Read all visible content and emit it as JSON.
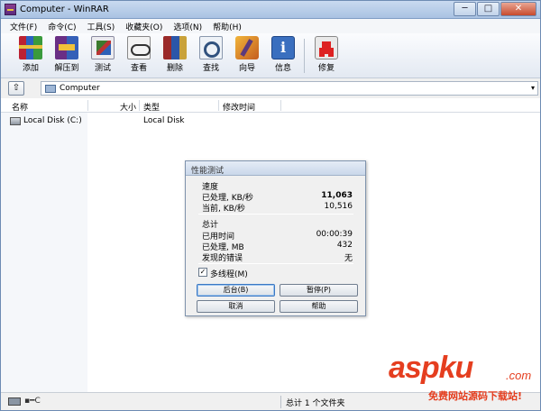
{
  "window": {
    "title": "Computer - WinRAR",
    "minimize": "─",
    "maximize": "□",
    "close": "✕"
  },
  "menu": [
    "文件(F)",
    "命令(C)",
    "工具(S)",
    "收藏夹(O)",
    "选项(N)",
    "帮助(H)"
  ],
  "toolbar": {
    "items": [
      {
        "label": "添加",
        "icon": "add-icon"
      },
      {
        "label": "解压到",
        "icon": "extract-icon"
      },
      {
        "label": "测试",
        "icon": "test-icon"
      },
      {
        "label": "查看",
        "icon": "view-icon"
      },
      {
        "label": "删除",
        "icon": "delete-icon"
      },
      {
        "label": "查找",
        "icon": "find-icon"
      },
      {
        "label": "向导",
        "icon": "wizard-icon"
      },
      {
        "label": "信息",
        "icon": "info-icon"
      },
      {
        "label": "修复",
        "icon": "repair-icon"
      }
    ]
  },
  "address": {
    "up": "⇧",
    "path": "Computer",
    "dropdown": "▾"
  },
  "list": {
    "columns": [
      "名称",
      "大小",
      "类型",
      "修改时间"
    ],
    "rows": [
      {
        "name": "Local Disk (C:)",
        "size": "",
        "type": "Local Disk",
        "modified": ""
      }
    ]
  },
  "dialog": {
    "title": "性能测试",
    "speed_group": "速度",
    "processed_speed_label": "已处理, KB/秒",
    "processed_speed_value": "11,063",
    "current_speed_label": "当前, KB/秒",
    "current_speed_value": "10,516",
    "total_group": "总计",
    "elapsed_label": "已用时间",
    "elapsed_value": "00:00:39",
    "processed_mb_label": "已处理, MB",
    "processed_mb_value": "432",
    "errors_label": "发现的错误",
    "errors_value": "无",
    "multithread_label": "多线程(M)",
    "multithread_checked": "✓",
    "background_btn": "后台(B)",
    "pause_btn": "暂停(P)",
    "cancel_btn": "取消",
    "help_btn": "帮助"
  },
  "status": {
    "left": "▪━C",
    "summary": "总计 1 个文件夹"
  },
  "watermark": {
    "brand": "aspku",
    "tld": ".com",
    "slogan": "免费网站源码下载站!"
  }
}
